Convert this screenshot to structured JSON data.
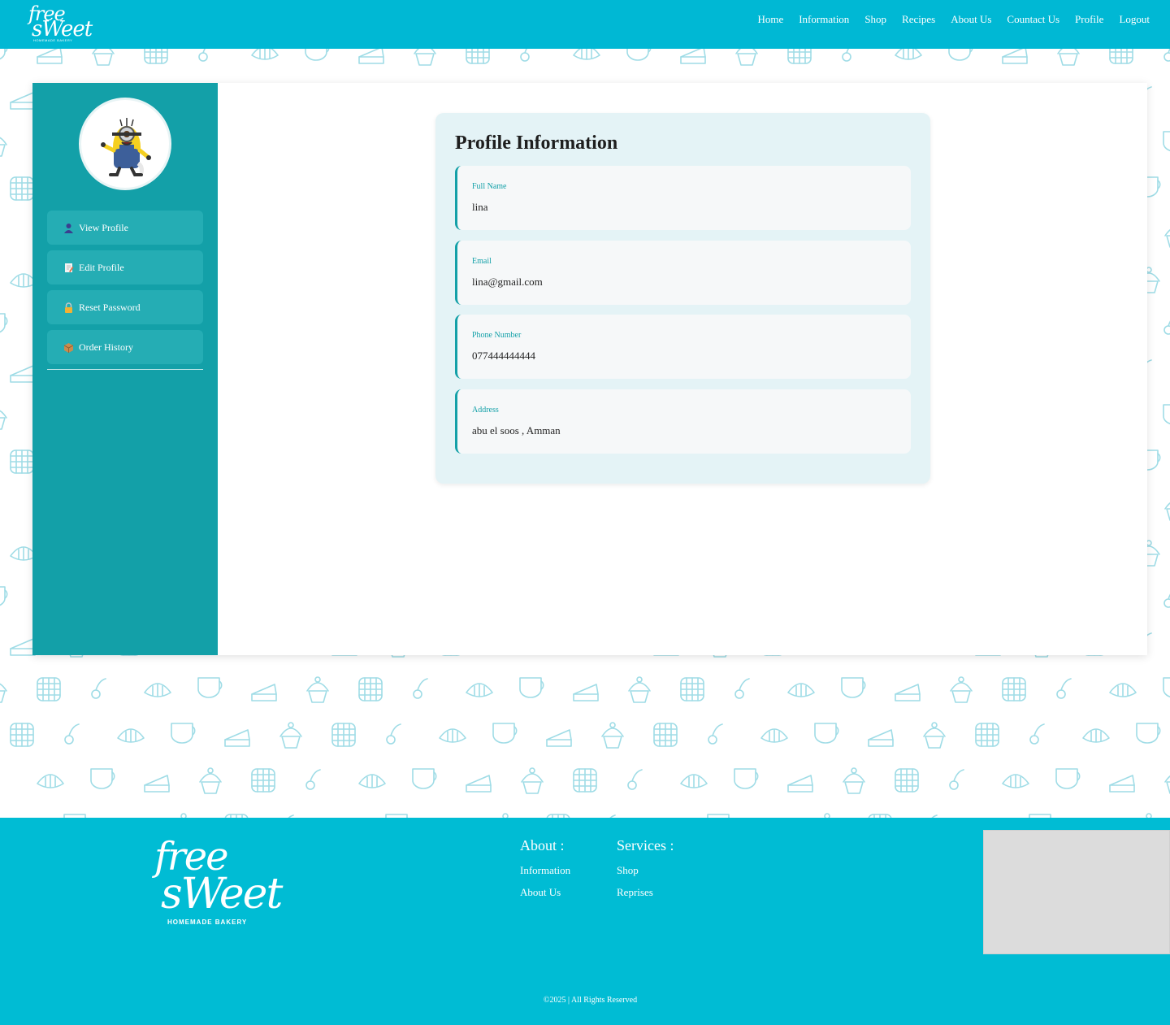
{
  "brand": {
    "logo_word1": "free",
    "logo_word2": "sWeet",
    "logo_tagline": "HOMEMADE BAKERY"
  },
  "nav": {
    "items": [
      {
        "label": "Home"
      },
      {
        "label": "Information"
      },
      {
        "label": "Shop"
      },
      {
        "label": "Recipes"
      },
      {
        "label": "About Us"
      },
      {
        "label": "Countact Us"
      },
      {
        "label": "Profile"
      },
      {
        "label": "Logout"
      }
    ]
  },
  "sidebar": {
    "avatar_icon": "minion-avatar",
    "items": [
      {
        "label": "View Profile",
        "icon": "user-icon"
      },
      {
        "label": "Edit Profile",
        "icon": "edit-document-icon"
      },
      {
        "label": "Reset Password",
        "icon": "lock-icon"
      },
      {
        "label": "Order History",
        "icon": "package-icon"
      }
    ]
  },
  "profile": {
    "title": "Profile Information",
    "fields": [
      {
        "label": "Full Name",
        "value": "lina"
      },
      {
        "label": "Email",
        "value": "lina@gmail.com"
      },
      {
        "label": "Phone Number",
        "value": "077444444444"
      },
      {
        "label": "Address",
        "value": "abu el soos , Amman"
      }
    ]
  },
  "footer": {
    "about": {
      "heading": "About :",
      "links": [
        {
          "label": "Information"
        },
        {
          "label": "About Us"
        }
      ]
    },
    "services": {
      "heading": "Services :",
      "links": [
        {
          "label": "Shop"
        },
        {
          "label": "Reprises"
        }
      ]
    },
    "copyright": "©2025 | All Rights Reserved"
  },
  "colors": {
    "header": "#00b8d4",
    "sidebar": "#13a0a8",
    "accent": "#13a0a8",
    "footer": "#00bcd4",
    "pattern": "#9fdce6"
  }
}
